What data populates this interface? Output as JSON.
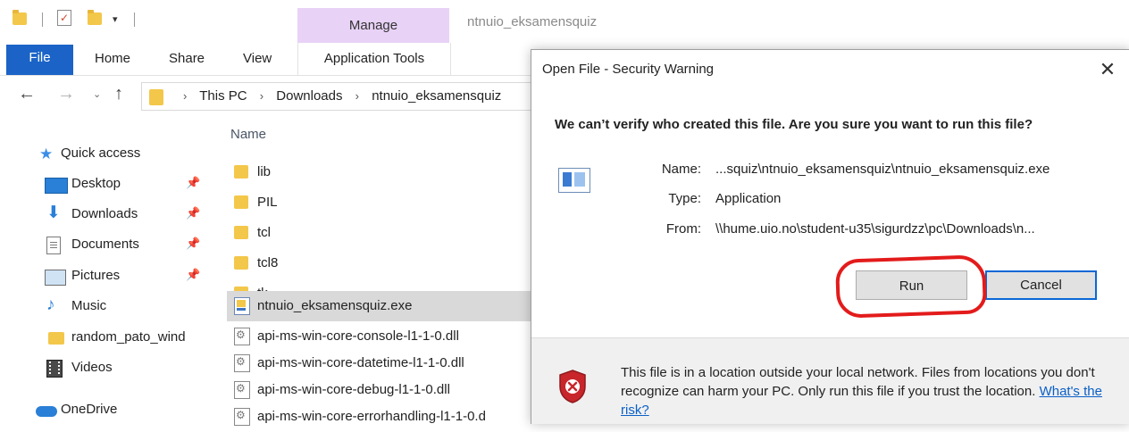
{
  "explorer": {
    "window_title": "ntnuio_eksamensquiz",
    "manage_tab": "Manage",
    "ribbon_tabs": {
      "file": "File",
      "home": "Home",
      "share": "Share",
      "view": "View",
      "app_tools": "Application Tools"
    },
    "breadcrumb": [
      "This PC",
      "Downloads",
      "ntnuio_eksamensquiz"
    ],
    "sidebar": {
      "quick_access": "Quick access",
      "items": [
        {
          "label": "Desktop",
          "icon": "desktop-icon",
          "pinned": true
        },
        {
          "label": "Downloads",
          "icon": "download-icon",
          "pinned": true
        },
        {
          "label": "Documents",
          "icon": "document-icon",
          "pinned": true
        },
        {
          "label": "Pictures",
          "icon": "pictures-icon",
          "pinned": true
        },
        {
          "label": "Music",
          "icon": "music-icon",
          "pinned": false
        },
        {
          "label": "random_pato_wind",
          "icon": "folder-icon",
          "pinned": false
        },
        {
          "label": "Videos",
          "icon": "videos-icon",
          "pinned": false
        }
      ],
      "onedrive": "OneDrive"
    },
    "column_header": "Name",
    "files": [
      {
        "name": "lib",
        "type": "folder"
      },
      {
        "name": "PIL",
        "type": "folder"
      },
      {
        "name": "tcl",
        "type": "folder"
      },
      {
        "name": "tcl8",
        "type": "folder"
      },
      {
        "name": "tk",
        "type": "folder"
      },
      {
        "name": "ntnuio_eksamensquiz.exe",
        "type": "exe",
        "selected": true
      },
      {
        "name": "api-ms-win-core-console-l1-1-0.dll",
        "type": "dll"
      },
      {
        "name": "api-ms-win-core-datetime-l1-1-0.dll",
        "type": "dll"
      },
      {
        "name": "api-ms-win-core-debug-l1-1-0.dll",
        "type": "dll"
      },
      {
        "name": "api-ms-win-core-errorhandling-l1-1-0.d",
        "type": "dll"
      }
    ]
  },
  "dialog": {
    "title": "Open File - Security Warning",
    "heading": "We can’t verify who created this file. Are you sure you want to run this file?",
    "name_label": "Name:",
    "name_value": "...squiz\\ntnuio_eksamensquiz\\ntnuio_eksamensquiz.exe",
    "type_label": "Type:",
    "type_value": "Application",
    "from_label": "From:",
    "from_value": "\\\\hume.uio.no\\student-u35\\sigurdzz\\pc\\Downloads\\n...",
    "run_button": "Run",
    "cancel_button": "Cancel",
    "footer_text": "This file is in a location outside your local network. Files from locations you don't recognize can harm your PC. Only run this file if you trust the location.",
    "footer_link": "What's the risk?"
  },
  "colors": {
    "accent": "#1b63c7",
    "manage": "#e8d2f6",
    "annotation": "#e31b1b",
    "link": "#0a5fc7"
  }
}
